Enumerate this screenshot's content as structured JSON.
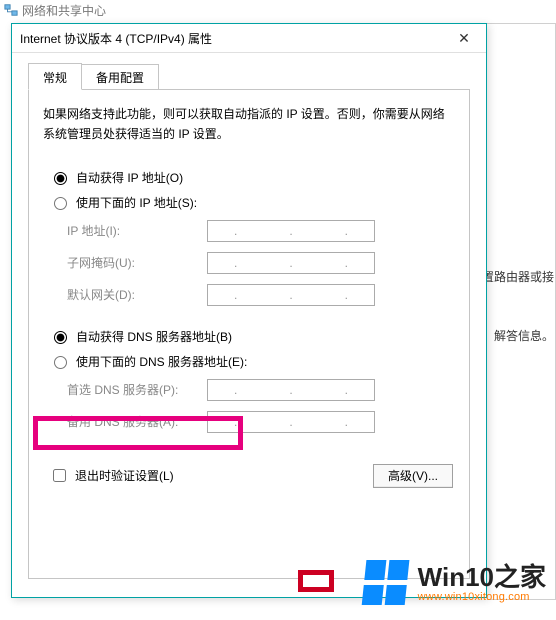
{
  "bg": {
    "title": "网络和共享中心",
    "right_lines": [
      "置路由器或接",
      "解答信息。"
    ]
  },
  "dialog": {
    "title": "Internet 协议版本 4 (TCP/IPv4) 属性",
    "close_tooltip": "关闭",
    "tabs": {
      "general": "常规",
      "alternate": "备用配置"
    },
    "description": "如果网络支持此功能，则可以获取自动指派的 IP 设置。否则，你需要从网络系统管理员处获得适当的 IP 设置。",
    "ip_section": {
      "auto": "自动获得 IP 地址(O)",
      "manual": "使用下面的 IP 地址(S):",
      "fields": {
        "ip": "IP 地址(I):",
        "mask": "子网掩码(U):",
        "gateway": "默认网关(D):"
      }
    },
    "dns_section": {
      "auto": "自动获得 DNS 服务器地址(B)",
      "manual": "使用下面的 DNS 服务器地址(E):",
      "fields": {
        "preferred": "首选 DNS 服务器(P):",
        "alternate": "备用 DNS 服务器(A):"
      }
    },
    "validate": "退出时验证设置(L)",
    "advanced": "高级(V)..."
  },
  "watermark": {
    "text": "Win10之家",
    "url": "www.win10xitong.com"
  }
}
